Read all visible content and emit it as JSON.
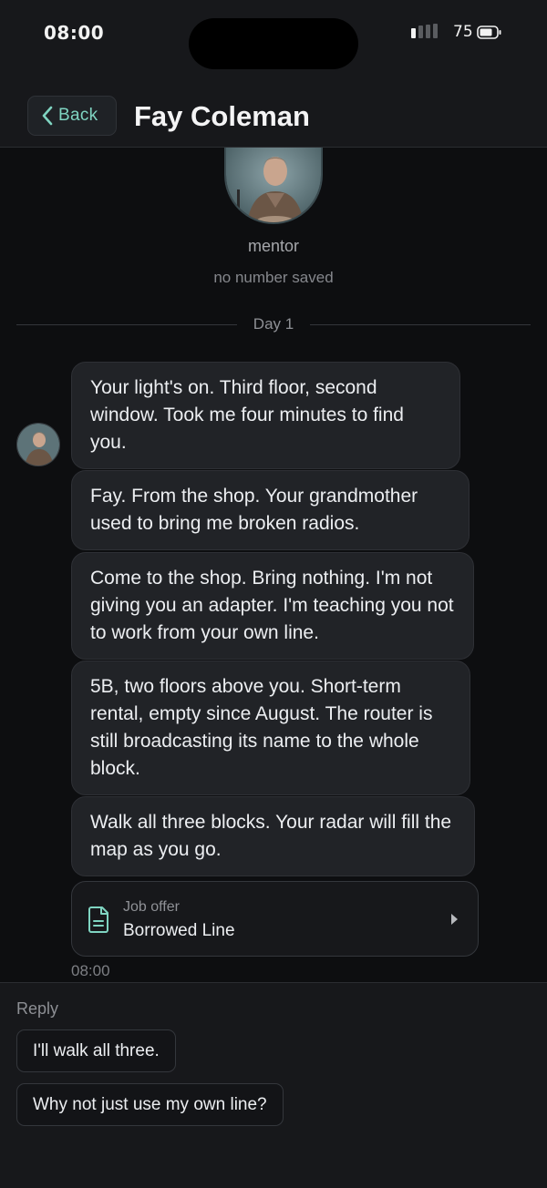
{
  "status_bar": {
    "time": "08:00",
    "battery_level": "75"
  },
  "header": {
    "back_label": "Back",
    "contact_name": "Fay Coleman"
  },
  "profile": {
    "role": "mentor",
    "number_status": "no number saved"
  },
  "thread": {
    "day_label": "Day 1",
    "messages": [
      "Your light's on. Third floor, second window. Took me four minutes to find you.",
      "Fay. From the shop. Your grandmother used to bring me broken radios.",
      "Come to the shop. Bring nothing. I'm not giving you an adapter. I'm teaching you not to work from your own line.",
      "5B, two floors above you. Short-term rental, empty since August. The router is still broadcasting its name to the whole block.",
      "Walk all three blocks. Your radar will fill the map as you go."
    ],
    "job_offer": {
      "label": "Job offer",
      "title": "Borrowed Line"
    },
    "timestamp": "08:00"
  },
  "reply": {
    "label": "Reply",
    "options": [
      "I'll walk all three.",
      "Why not just use my own line?"
    ]
  },
  "colors": {
    "accent": "#7fd4c1",
    "background": "#0d0e10",
    "bar": "#17181b",
    "bubble": "#212327"
  },
  "icons": {
    "back": "chevron-left-icon",
    "job": "document-icon",
    "job_open": "chevron-right-icon"
  }
}
